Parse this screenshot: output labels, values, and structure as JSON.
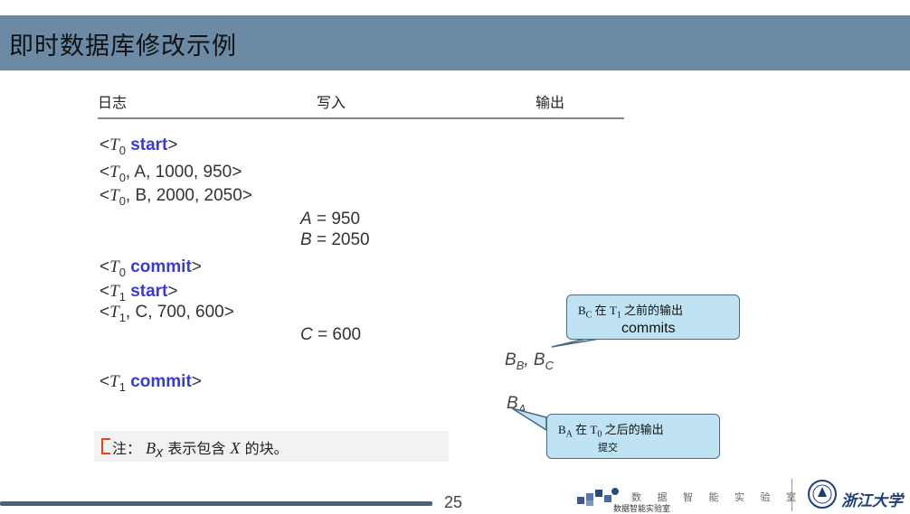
{
  "slide": {
    "title": "即时数据库修改示例",
    "page_number": "25"
  },
  "table": {
    "headers": {
      "log": "日志",
      "write": "写入",
      "output": "输出"
    }
  },
  "log": {
    "row1": {
      "t": "T",
      "sub": "0",
      "kw": "start"
    },
    "row2": {
      "t": "T",
      "sub": "0",
      "rest": ", A, 1000, 950>"
    },
    "row3": {
      "t": "T",
      "sub": "0",
      "rest": ", B, 2000, 2050>"
    },
    "row4": {
      "t": "T",
      "sub": "0",
      "kw": "commit"
    },
    "row5": {
      "t": "T",
      "sub": "1",
      "kw": "start"
    },
    "row6": {
      "t": "T",
      "sub": "1",
      "rest": ", C, 700, 600>"
    },
    "row7": {
      "t": "T",
      "sub": "1",
      "kw": "commit"
    }
  },
  "writes": {
    "a": {
      "var": "A",
      "val": " = 950"
    },
    "b": {
      "var": "B",
      "val": " = 2050"
    },
    "c": {
      "var": "C",
      "val": " = 600"
    }
  },
  "outputs": {
    "bb_bc": {
      "b1": "B",
      "s1": "B",
      "sep": ", ",
      "b2": "B",
      "s2": "C"
    },
    "ba": {
      "b": "B",
      "s": "A"
    }
  },
  "callouts": {
    "first": {
      "prefix": "B",
      "prefix_sub": "C",
      "middle": " 在 T",
      "t_sub": "1",
      "suffix": " 之前的输出",
      "line2": "commits"
    },
    "second": {
      "prefix": "B",
      "prefix_sub": "A",
      "middle": " 在 T",
      "t_sub": "0",
      "suffix": " 之后的输出",
      "line2": "提交"
    }
  },
  "note": {
    "label": "注：",
    "var": "B",
    "var_sub": "X",
    "mid": " 表示包含 ",
    "x": "X",
    "end": " 的块。"
  },
  "footer": {
    "lab_name": "数 据 智 能 实 验 室",
    "lab_sub": "数据智能实验室",
    "university": "浙江大学"
  },
  "colors": {
    "title_bar": "#6b8aa6",
    "keyword": "#3b3bd4",
    "callout_fill": "#bfe3f3",
    "footer_line": "#49607a",
    "note_marker": "#e8461a"
  }
}
